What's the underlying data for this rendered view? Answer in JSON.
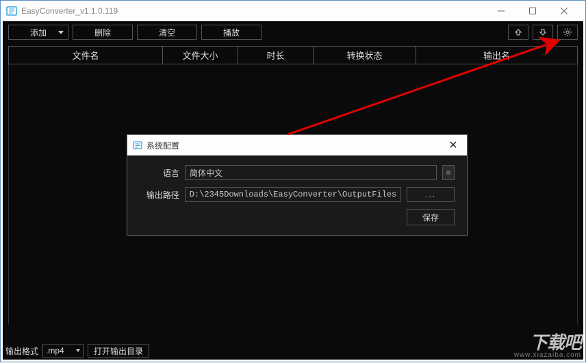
{
  "window": {
    "title": "EasyConverter_v1.1.0.119"
  },
  "toolbar": {
    "add": "添加",
    "delete": "删除",
    "clear": "清空",
    "play": "播放"
  },
  "columns": {
    "filename": "文件名",
    "filesize": "文件大小",
    "duration": "时长",
    "status": "转换状态",
    "output": "输出名"
  },
  "bottom": {
    "format_label": "输出格式",
    "format_value": ".mp4",
    "open_dir": "打开输出目录"
  },
  "dialog": {
    "title": "系统配置",
    "lang_label": "语言",
    "lang_value": "简体中文",
    "path_label": "输出路径",
    "path_value": "D:\\2345Downloads\\EasyConverter\\OutputFiles",
    "browse": "...",
    "save": "保存"
  },
  "watermark": {
    "text": "下载吧",
    "url": "www.xiazaiba.com"
  }
}
